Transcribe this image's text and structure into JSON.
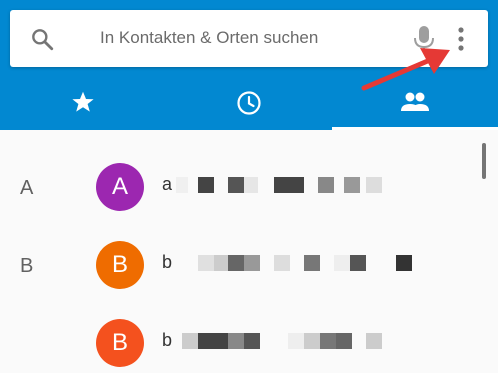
{
  "search": {
    "placeholder": "In Kontakten & Orten suchen"
  },
  "icons": {
    "search": "search-icon",
    "mic": "microphone-icon",
    "more": "more-vert-icon",
    "favorites": "star-icon",
    "recents": "clock-icon",
    "contacts": "people-icon",
    "annotation": "red-arrow-annotation"
  },
  "tabs": [
    {
      "name": "favorites",
      "icon": "star-icon",
      "active": false
    },
    {
      "name": "recents",
      "icon": "clock-icon",
      "active": false
    },
    {
      "name": "contacts",
      "icon": "people-icon",
      "active": true
    }
  ],
  "contacts": [
    {
      "section": "A",
      "initial": "A",
      "name_first_char": "a",
      "avatar_color": "#9c27b0"
    },
    {
      "section": "B",
      "initial": "B",
      "name_first_char": "b",
      "avatar_color": "#ef6c00"
    },
    {
      "section": "",
      "initial": "B",
      "name_first_char": "b",
      "avatar_color": "#f4511e"
    }
  ],
  "colors": {
    "appbar": "#0288d1",
    "arrow": "#e53935",
    "list_background": "#fafafa"
  }
}
